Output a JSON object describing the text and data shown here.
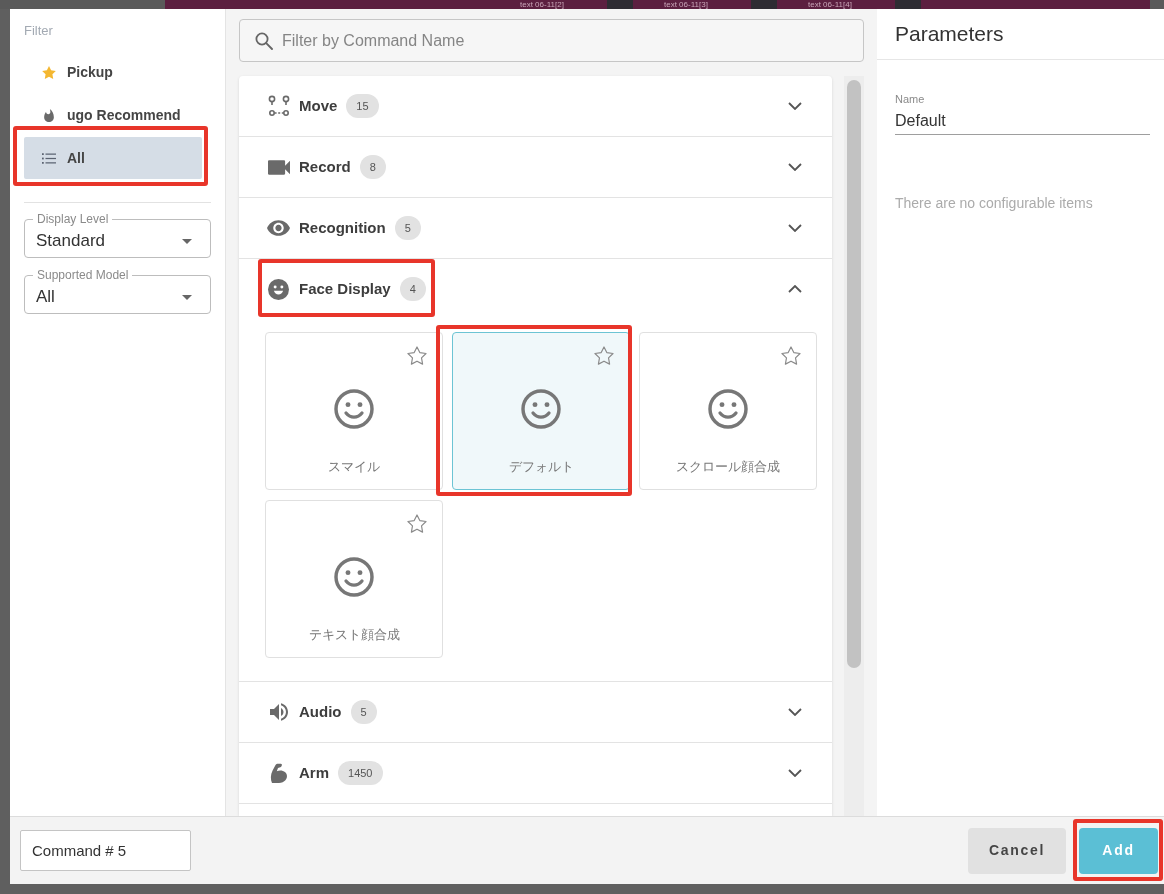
{
  "background_app": {
    "tabs": [
      {
        "label": "text 06-11[2]"
      },
      {
        "label": "text 06-11[3]"
      },
      {
        "label": "text 06-11[4]"
      }
    ]
  },
  "filter_panel": {
    "title": "Filter",
    "items": [
      {
        "label": "Pickup",
        "selected": false
      },
      {
        "label": "ugo Recommend",
        "selected": false
      },
      {
        "label": "All",
        "selected": true,
        "highlighted": true
      }
    ],
    "selects": [
      {
        "label": "Display Level",
        "value": "Standard"
      },
      {
        "label": "Supported Model",
        "value": "All"
      }
    ]
  },
  "search": {
    "placeholder": "Filter by Command Name"
  },
  "categories": [
    {
      "name": "Move",
      "count": "15",
      "expanded": false
    },
    {
      "name": "Record",
      "count": "8",
      "expanded": false
    },
    {
      "name": "Recognition",
      "count": "5",
      "expanded": false
    },
    {
      "name": "Face Display",
      "count": "4",
      "expanded": true,
      "highlighted": true,
      "commands": [
        {
          "label": "スマイル",
          "selected": false,
          "favorite": false
        },
        {
          "label": "デフォルト",
          "selected": true,
          "favorite": false,
          "highlighted": true
        },
        {
          "label": "スクロール顔合成",
          "selected": false,
          "favorite": false
        },
        {
          "label": "テキスト顔合成",
          "selected": false,
          "favorite": false
        }
      ]
    },
    {
      "name": "Audio",
      "count": "5",
      "expanded": false
    },
    {
      "name": "Arm",
      "count": "1450",
      "expanded": false
    }
  ],
  "parameters": {
    "title": "Parameters",
    "fields": [
      {
        "label": "Name",
        "value": "Default"
      }
    ],
    "empty_message": "There are no configurable items"
  },
  "footer": {
    "command_name": {
      "value": "Command # 5"
    },
    "buttons": [
      {
        "label": "Cancel",
        "kind": "secondary"
      },
      {
        "label": "Add",
        "kind": "primary",
        "highlighted": true
      }
    ]
  }
}
